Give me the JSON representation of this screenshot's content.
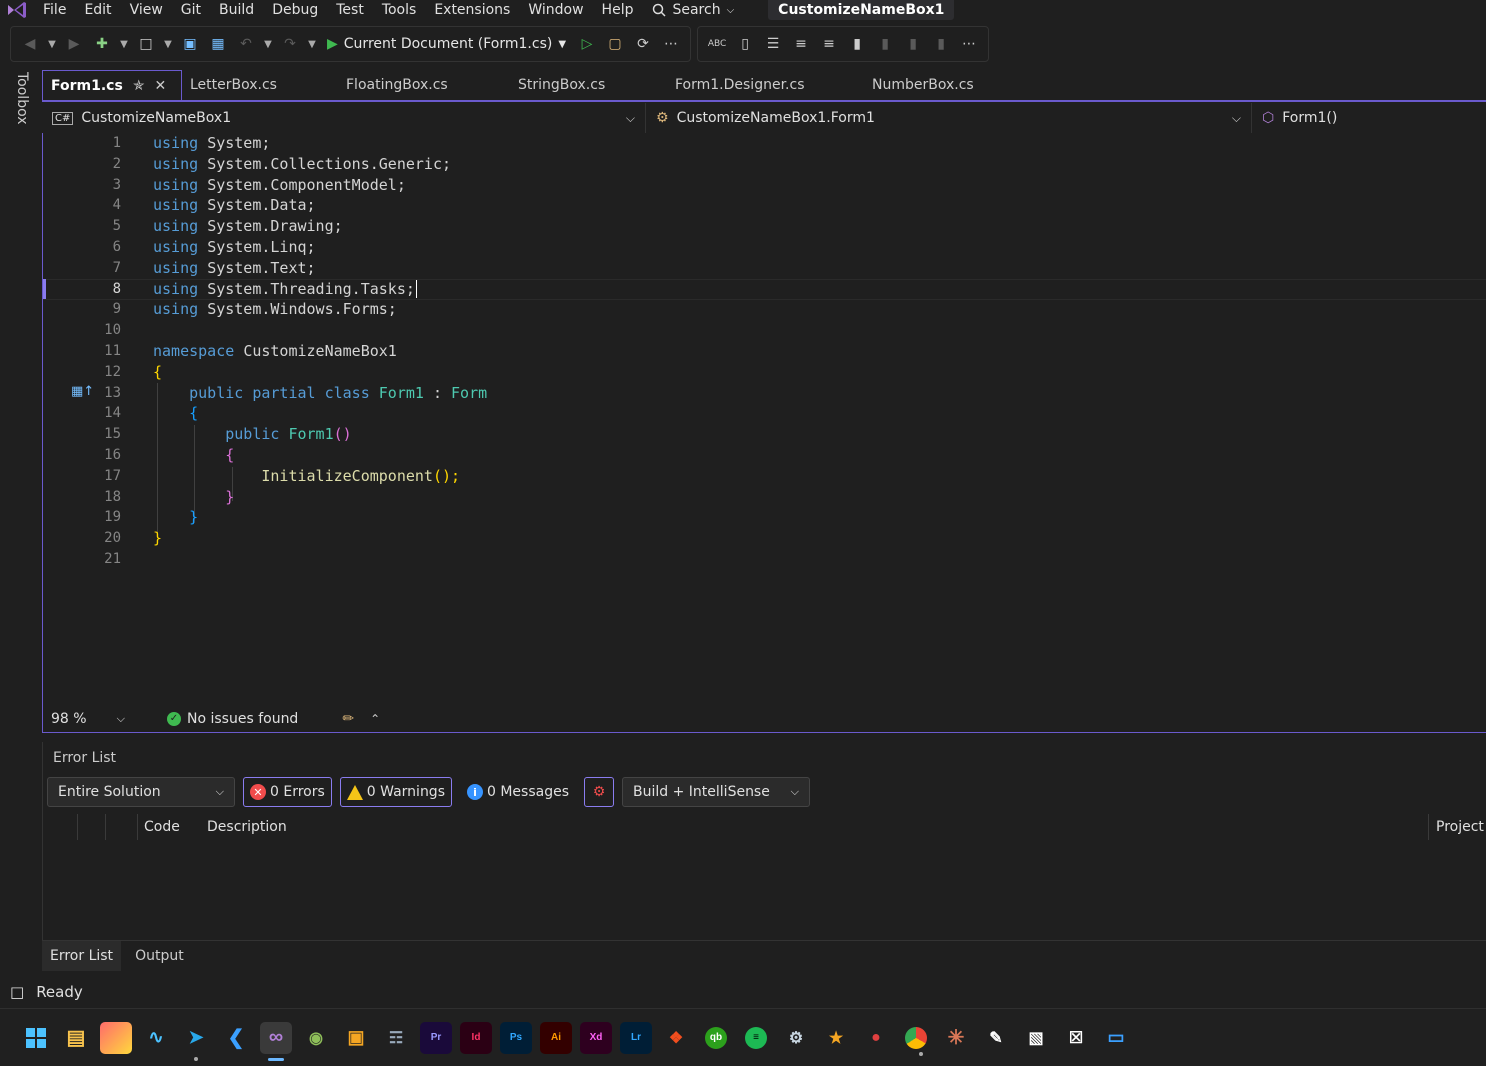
{
  "menubar": {
    "items": [
      "File",
      "Edit",
      "View",
      "Git",
      "Build",
      "Debug",
      "Test",
      "Tools",
      "Extensions",
      "Window",
      "Help"
    ],
    "search_label": "Search",
    "solution_title": "CustomizeNameBox1"
  },
  "toolbar": {
    "run_label": "Current Document (Form1.cs)"
  },
  "toolbox": {
    "label": "Toolbox"
  },
  "tabs": [
    {
      "label": "Form1.cs",
      "active": true
    },
    {
      "label": "LetterBox.cs"
    },
    {
      "label": "FloatingBox.cs"
    },
    {
      "label": "StringBox.cs"
    },
    {
      "label": "Form1.Designer.cs"
    },
    {
      "label": "NumberBox.cs"
    }
  ],
  "navbar": {
    "project": "CustomizeNameBox1",
    "type": "CustomizeNameBox1.Form1",
    "member": "Form1()"
  },
  "editor": {
    "current_line": 8,
    "line_numbers": [
      "1",
      "2",
      "3",
      "4",
      "5",
      "6",
      "7",
      "8",
      "9",
      "10",
      "11",
      "12",
      "13",
      "14",
      "15",
      "16",
      "17",
      "18",
      "19",
      "20",
      "21"
    ],
    "code": {
      "using": "using",
      "system": "System",
      "l1": "System;",
      "l2a": "System.Collections.Generic;",
      "l3a": "System.ComponentModel;",
      "l4a": "System.Data;",
      "l5a": "System.Drawing;",
      "l6a": "System.Linq;",
      "l7a": "System.Text;",
      "l8a": "System.Threading.Tasks;",
      "l9a": "System.Windows.Forms;",
      "namespace_kw": "namespace",
      "namespace_name": "CustomizeNameBox1",
      "open_brace": "{",
      "close_brace": "}",
      "public_kw": "public",
      "partial_kw": "partial",
      "class_kw": "class",
      "class_name": "Form1",
      "colon": ":",
      "base_class": "Form",
      "ctor_name": "Form1",
      "parens": "()",
      "init_call": "InitializeComponent",
      "init_tail": "();"
    }
  },
  "editor_status": {
    "zoom": "98 %",
    "issues": "No issues found"
  },
  "error_list": {
    "title": "Error List",
    "scope": "Entire Solution",
    "errors": "0 Errors",
    "warnings": "0 Warnings",
    "messages": "0 Messages",
    "filter": "Build + IntelliSense",
    "col_code": "Code",
    "col_description": "Description",
    "col_project": "Project"
  },
  "bottom_tabs": [
    "Error List",
    "Output"
  ],
  "statusbar": {
    "text": "Ready"
  },
  "colors": {
    "accent": "#6a5acd",
    "keyword": "#569cd6",
    "type": "#4ec9b0",
    "method": "#dcdcaa"
  }
}
